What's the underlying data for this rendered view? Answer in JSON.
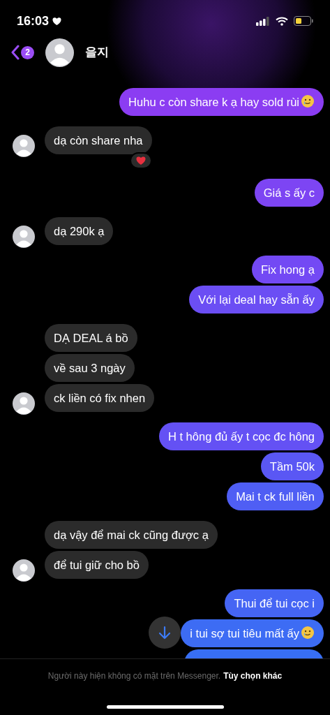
{
  "status_bar": {
    "time": "16:03"
  },
  "header": {
    "back_badge": "2",
    "name": "을지"
  },
  "groups": [
    {
      "kind": "sent",
      "messages": [
        {
          "kind": "text",
          "text": "Huhu c còn share k ạ hay sold rùi",
          "emoji_end": true
        }
      ]
    },
    {
      "kind": "received",
      "messages": [
        {
          "kind": "text",
          "text": "dạ còn share nha",
          "reaction": {
            "kind": "heart"
          }
        }
      ]
    },
    {
      "kind": "sent",
      "messages": [
        {
          "kind": "text",
          "text": "Giá s ấy c"
        }
      ]
    },
    {
      "kind": "received",
      "messages": [
        {
          "kind": "text",
          "text": "dạ 290k ạ"
        }
      ]
    },
    {
      "kind": "sent",
      "messages": [
        {
          "kind": "text",
          "text": "Fix hong ạ"
        },
        {
          "kind": "text",
          "text": "Với lại deal hay sẵn ấy"
        }
      ]
    },
    {
      "kind": "received",
      "messages": [
        {
          "kind": "text",
          "text": "DẠ DEAL á bồ"
        },
        {
          "kind": "text",
          "text": "về sau 3 ngày"
        },
        {
          "kind": "text",
          "text": "ck liền có fix nhen"
        }
      ]
    },
    {
      "kind": "sent",
      "messages": [
        {
          "kind": "text",
          "text": "H t hông đủ ấy t cọc đc hông"
        },
        {
          "kind": "text",
          "text": "Tầm 50k"
        },
        {
          "kind": "text",
          "text": "Mai t ck full liền"
        }
      ]
    },
    {
      "kind": "received",
      "messages": [
        {
          "kind": "text",
          "text": "dạ vậy để mai ck cũng được ạ"
        },
        {
          "kind": "text",
          "text": "để tui giữ cho bồ"
        }
      ]
    },
    {
      "kind": "sent",
      "messages": [
        {
          "kind": "text",
          "text": "Thui để tui cọc i"
        },
        {
          "kind": "text",
          "text": "i tui sợ tui tiêu mất ấy",
          "emoji_end": true
        },
        {
          "kind": "clipped"
        }
      ]
    }
  ],
  "footer": {
    "notice": "Người này hiện không có mặt trên Messenger.",
    "link": "Tùy chọn khác"
  }
}
